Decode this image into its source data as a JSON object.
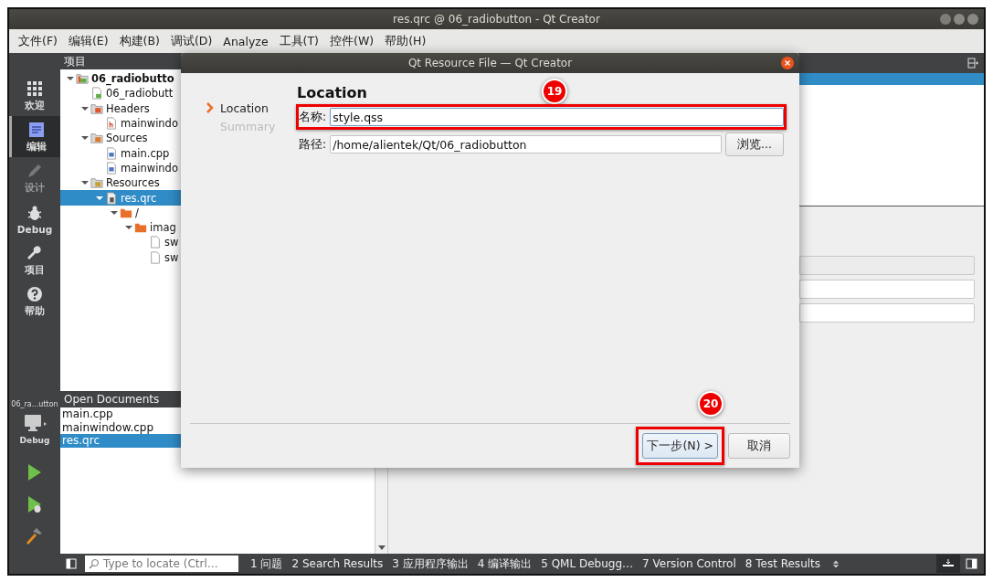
{
  "window": {
    "title": "res.qrc @ 06_radiobutton - Qt Creator"
  },
  "menu": [
    {
      "label": "文件(F)"
    },
    {
      "label": "编辑(E)"
    },
    {
      "label": "构建(B)"
    },
    {
      "label": "调试(D)"
    },
    {
      "label": "Analyze"
    },
    {
      "label": "工具(T)"
    },
    {
      "label": "控件(W)"
    },
    {
      "label": "帮助(H)"
    }
  ],
  "modes": [
    {
      "label": "欢迎",
      "kind": "welcome",
      "selected": false,
      "disabled": false
    },
    {
      "label": "编辑",
      "kind": "edit",
      "selected": true,
      "disabled": false
    },
    {
      "label": "设计",
      "kind": "design",
      "selected": false,
      "disabled": true
    },
    {
      "label": "Debug",
      "kind": "debug",
      "selected": false,
      "disabled": false
    },
    {
      "label": "项目",
      "kind": "projects",
      "selected": false,
      "disabled": false
    },
    {
      "label": "帮助",
      "kind": "help",
      "selected": false,
      "disabled": false
    }
  ],
  "kit": {
    "project": "06_ra...utton",
    "config": "Debug"
  },
  "actions": [
    {
      "kind": "run"
    },
    {
      "kind": "debug-run"
    },
    {
      "kind": "build"
    }
  ],
  "project_panel": {
    "title": "项目",
    "tree": [
      {
        "label": "06_radiobutto",
        "kind": "project",
        "expanded": true,
        "selected": false,
        "children": [
          {
            "label": "06_radiobutt",
            "kind": "pro",
            "selected": false
          },
          {
            "label": "Headers",
            "kind": "headers",
            "expanded": true,
            "selected": false,
            "children": [
              {
                "label": "mainwindo",
                "kind": "header",
                "selected": false
              }
            ]
          },
          {
            "label": "Sources",
            "kind": "sources",
            "expanded": true,
            "selected": false,
            "children": [
              {
                "label": "main.cpp",
                "kind": "source",
                "selected": false
              },
              {
                "label": "mainwindo",
                "kind": "source",
                "selected": false
              }
            ]
          },
          {
            "label": "Resources",
            "kind": "resources",
            "expanded": true,
            "selected": false,
            "children": [
              {
                "label": "res.qrc",
                "kind": "qrc",
                "expanded": true,
                "selected": true,
                "children": [
                  {
                    "label": "/",
                    "kind": "folder",
                    "expanded": true,
                    "selected": false,
                    "children": [
                      {
                        "label": "imag",
                        "kind": "folder",
                        "expanded": true,
                        "selected": false,
                        "children": [
                          {
                            "label": "sw",
                            "kind": "file",
                            "selected": false
                          },
                          {
                            "label": "sw",
                            "kind": "file",
                            "selected": false
                          }
                        ]
                      }
                    ]
                  }
                ]
              }
            ]
          }
        ]
      }
    ]
  },
  "open_documents": {
    "title": "Open Documents",
    "items": [
      {
        "label": "main.cpp",
        "selected": false
      },
      {
        "label": "mainwindow.cpp",
        "selected": false
      },
      {
        "label": "res.qrc",
        "selected": true
      }
    ]
  },
  "dialog": {
    "title": "Qt Resource File — Qt Creator",
    "steps": [
      {
        "label": "Location",
        "selected": true
      },
      {
        "label": "Summary",
        "selected": false
      }
    ],
    "heading": "Location",
    "fields": [
      {
        "label": "名称:",
        "value": "style.qss",
        "annotation": "19"
      },
      {
        "label": "路径:",
        "value": "/home/alientek/Qt/06_radiobutton",
        "button": "浏览..."
      }
    ],
    "buttons": [
      {
        "label": "下一步(N) >",
        "default": true,
        "annotation": "20"
      },
      {
        "label": "取消",
        "default": false
      }
    ]
  },
  "status_bar": {
    "locate_placeholder": "Type to locate (Ctrl…",
    "tabs": [
      {
        "num": "1",
        "label": "问题"
      },
      {
        "num": "2",
        "label": "Search Results"
      },
      {
        "num": "3",
        "label": "应用程序输出"
      },
      {
        "num": "4",
        "label": "编译输出"
      },
      {
        "num": "5",
        "label": "QML Debugg…"
      },
      {
        "num": "7",
        "label": "Version Control"
      },
      {
        "num": "8",
        "label": "Test Results"
      }
    ]
  }
}
